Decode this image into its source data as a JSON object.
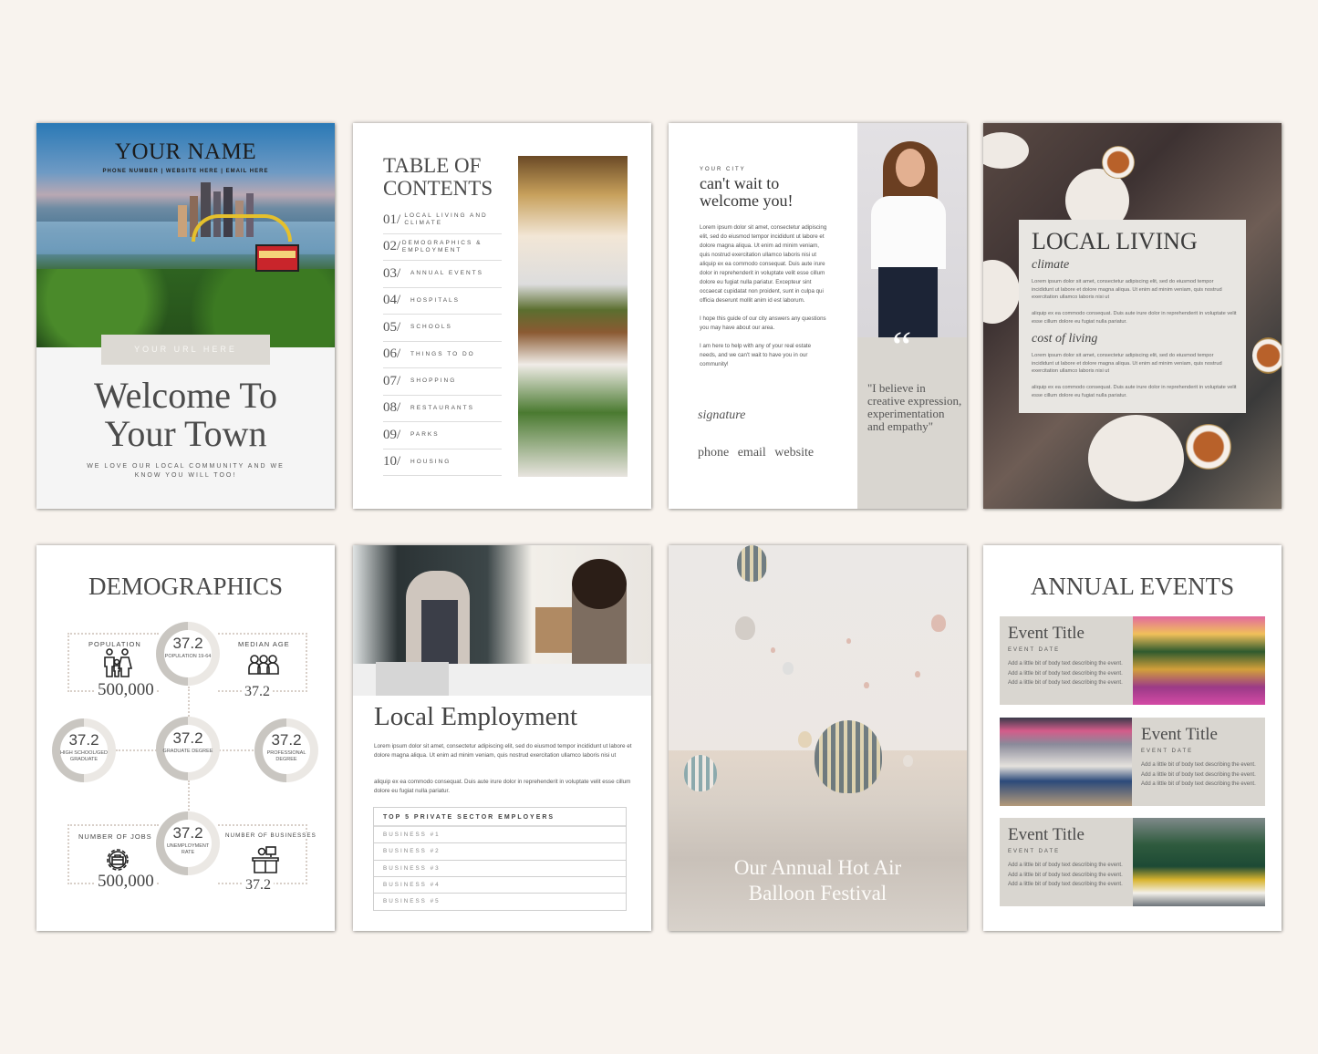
{
  "cover": {
    "name": "YOUR NAME",
    "contact": "PHONE NUMBER | WEBSITE HERE |  EMAIL HERE",
    "url": "YOUR URL HERE",
    "welcome_line1": "Welcome To",
    "welcome_line2": "Your Town",
    "tagline": "WE LOVE OUR LOCAL COMMUNITY AND WE KNOW YOU WILL TOO!"
  },
  "toc": {
    "title_line1": "TABLE OF",
    "title_line2": "CONTENTS",
    "items": [
      {
        "num": "01/",
        "label": "LOCAL LIVING AND CLIMATE"
      },
      {
        "num": "02/",
        "label": "DEMOGRAPHICS & EMPLOYMENT"
      },
      {
        "num": "03/",
        "label": "ANNUAL EVENTS"
      },
      {
        "num": "04/",
        "label": "HOSPITALS"
      },
      {
        "num": "05/",
        "label": "SCHOOLS"
      },
      {
        "num": "06/",
        "label": "THINGS TO DO"
      },
      {
        "num": "07/",
        "label": "SHOPPING"
      },
      {
        "num": "08/",
        "label": "RESTAURANTS"
      },
      {
        "num": "09/",
        "label": "PARKS"
      },
      {
        "num": "10/",
        "label": "HOUSING"
      }
    ]
  },
  "letter": {
    "eyebrow": "YOUR CITY",
    "heading_line1": "can't wait to",
    "heading_line2": "welcome you!",
    "paragraph1": "Lorem ipsum dolor sit amet, consectetur adipiscing elit, sed do eiusmod tempor incididunt ut labore et dolore magna aliqua. Ut enim ad minim veniam, quis nostrud exercitation ullamco laboris nisi ut aliquip ex ea commodo consequat. Duis aute irure dolor in reprehenderit in voluptate velit esse cillum dolore eu fugiat nulla pariatur. Excepteur sint occaecat cupidatat non proident, sunt in culpa qui officia deserunt mollit anim id est laborum.",
    "paragraph2": "I hope this guide of our city answers any questions you may have about our area.",
    "paragraph3": "I am here to help with any of your real estate needs, and we can't wait to have you in our community!",
    "signature": "signature",
    "contacts": "phone  email  website",
    "quote_mark": "“",
    "quote": "\"I believe in creative expression, experimentation and empathy\""
  },
  "local_living": {
    "title": "LOCAL LIVING",
    "climate_heading": "climate",
    "climate_p1": "Lorem ipsum dolor sit amet, consectetur adipiscing elit, sed do eiusmod tempor incididunt ut labore et dolore magna aliqua. Ut enim ad minim veniam, quis nostrud exercitation ullamco laboris nisi ut",
    "climate_p2": "aliquip ex ea commodo consequat. Duis aute irure dolor in reprehenderit in voluptate velit esse cillum dolore eu fugiat nulla pariatur.",
    "cost_heading": "cost of living",
    "cost_p1": "Lorem ipsum dolor sit amet, consectetur adipiscing elit, sed do eiusmod tempor incididunt ut labore et dolore magna aliqua. Ut enim ad minim veniam, quis nostrud exercitation ullamco laboris nisi ut",
    "cost_p2": "aliquip ex ea commodo consequat. Duis aute irure dolor in reprehenderit in voluptate velit esse cillum dolore eu fugiat nulla pariatur."
  },
  "demographics": {
    "title": "DEMOGRAPHICS",
    "population_label": "POPULATION",
    "population_value": "500,000",
    "population_icon": "family-icon",
    "median_age_label": "MEDIAN AGE",
    "median_age_value": "37.2",
    "median_age_icon": "group-icon",
    "jobs_label": "NUMBER OF JOBS",
    "jobs_value": "500,000",
    "jobs_icon": "briefcase-gear-icon",
    "businesses_label": "NUMBER OF BUSINESSES",
    "businesses_value": "37.2",
    "businesses_icon": "office-desk-icon",
    "rings": [
      {
        "value": "37.2",
        "label": "POPULATION 19-64",
        "fill_percent": 50
      },
      {
        "value": "37.2",
        "label": "HIGH SCHOOL/GED GRADUATE",
        "fill_percent": 50
      },
      {
        "value": "37.2",
        "label": "GRADUATE DEGREE",
        "fill_percent": 50
      },
      {
        "value": "37.2",
        "label": "PROFESSIONAL DEGREE",
        "fill_percent": 50
      },
      {
        "value": "37.2",
        "label": "UNEMPLOYMENT RATE",
        "fill_percent": 50
      }
    ]
  },
  "employment": {
    "title": "Local Employment",
    "p1": "Lorem ipsum dolor sit amet, consectetur adipiscing elit, sed do eiusmod tempor incididunt ut labore et dolore magna aliqua. Ut enim ad minim veniam, quis nostrud exercitation ullamco laboris nisi ut",
    "p2": "aliquip ex ea commodo consequat. Duis aute irure dolor in reprehenderit in voluptate velit esse cillum dolore eu fugiat nulla pariatur.",
    "table_header": "TOP 5 PRIVATE SECTOR EMPLOYERS",
    "businesses": [
      "BUSINESS #1",
      "BUSINESS #2",
      "BUSINESS #3",
      "BUSINESS #4",
      "BUSINESS #5"
    ]
  },
  "festival": {
    "title_line1": "Our Annual Hot Air",
    "title_line2": "Balloon Festival"
  },
  "events": {
    "title": "ANNUAL EVENTS",
    "items": [
      {
        "title": "Event Title",
        "date": "EVENT DATE",
        "body": "Add a little bit of body text describing the event. Add a little bit of body text describing the event. Add a little bit of body text describing the event."
      },
      {
        "title": "Event Title",
        "date": "EVENT DATE",
        "body": "Add a little bit of body text describing the event. Add a little bit of body text describing the event. Add a little bit of body text describing the event."
      },
      {
        "title": "Event Title",
        "date": "EVENT DATE",
        "body": "Add a little bit of body text describing the event. Add a little bit of body text describing the event. Add a little bit of body text describing the event."
      }
    ]
  }
}
